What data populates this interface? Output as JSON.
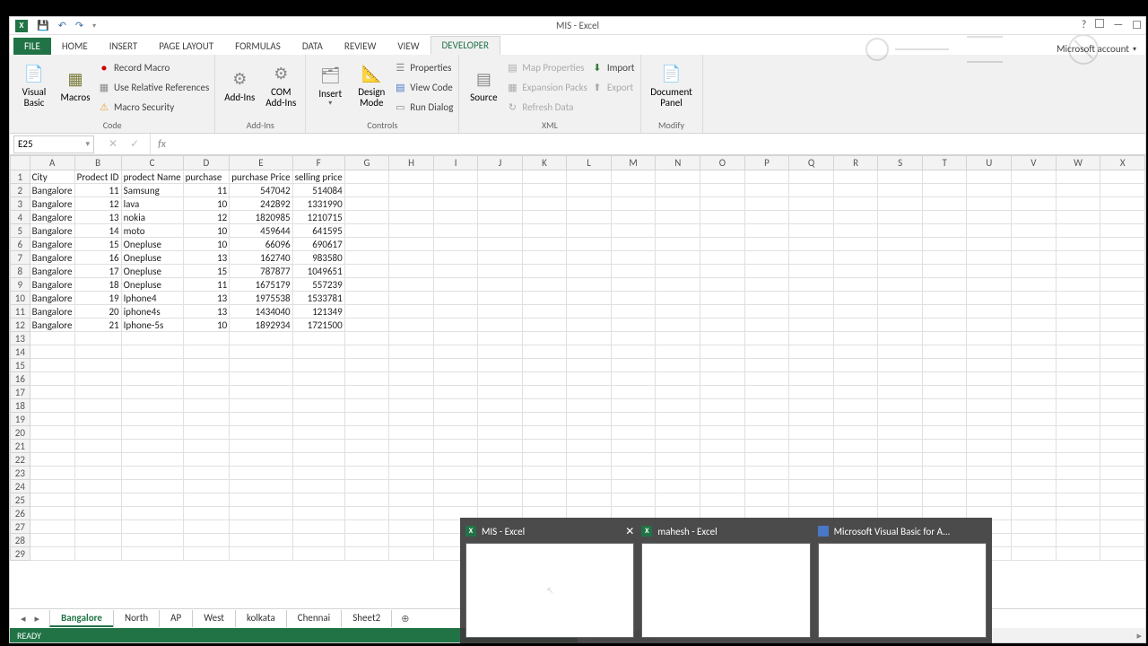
{
  "window": {
    "title": "MIS - Excel",
    "account": "Microsoft account"
  },
  "tabs": {
    "file": "FILE",
    "list": [
      "HOME",
      "INSERT",
      "PAGE LAYOUT",
      "FORMULAS",
      "DATA",
      "REVIEW",
      "VIEW",
      "DEVELOPER"
    ],
    "active": "DEVELOPER"
  },
  "ribbon": {
    "code": {
      "visual_basic": "Visual\nBasic",
      "macros": "Macros",
      "record": "Record Macro",
      "relref": "Use Relative References",
      "security": "Macro Security",
      "label": "Code"
    },
    "addins": {
      "addins": "Add-Ins",
      "com": "COM\nAdd-Ins",
      "label": "Add-Ins"
    },
    "controls": {
      "insert": "Insert",
      "design": "Design\nMode",
      "properties": "Properties",
      "viewcode": "View Code",
      "rundialog": "Run Dialog",
      "label": "Controls"
    },
    "xml": {
      "source": "Source",
      "mapprops": "Map Properties",
      "expansion": "Expansion Packs",
      "refresh": "Refresh Data",
      "import": "Import",
      "export": "Export",
      "label": "XML"
    },
    "modify": {
      "docpanel": "Document\nPanel",
      "label": "Modify"
    }
  },
  "namebox": "E25",
  "columns": [
    "A",
    "B",
    "C",
    "D",
    "E",
    "F",
    "G",
    "H",
    "I",
    "J",
    "K",
    "L",
    "M",
    "N",
    "O",
    "P",
    "Q",
    "R",
    "S",
    "T",
    "U",
    "V",
    "W",
    "X"
  ],
  "headers": [
    "City",
    "Prodect ID",
    "prodect Name",
    "purchase",
    "purchase Price",
    "selling price"
  ],
  "rows": [
    [
      "Bangalore",
      "11",
      "Samsung",
      "11",
      "547042",
      "514084"
    ],
    [
      "Bangalore",
      "12",
      "lava",
      "10",
      "242892",
      "1331990"
    ],
    [
      "Bangalore",
      "13",
      "nokia",
      "12",
      "1820985",
      "1210715"
    ],
    [
      "Bangalore",
      "14",
      "moto",
      "10",
      "459644",
      "641595"
    ],
    [
      "Bangalore",
      "15",
      "Onepluse",
      "10",
      "66096",
      "690617"
    ],
    [
      "Bangalore",
      "16",
      "Onepluse",
      "13",
      "162740",
      "983580"
    ],
    [
      "Bangalore",
      "17",
      "Onepluse",
      "15",
      "787877",
      "1049651"
    ],
    [
      "Bangalore",
      "18",
      "Onepluse",
      "11",
      "1675179",
      "557239"
    ],
    [
      "Bangalore",
      "19",
      "Iphone4",
      "13",
      "1975538",
      "1533781"
    ],
    [
      "Bangalore",
      "20",
      "iphone4s",
      "13",
      "1434040",
      "121349"
    ],
    [
      "Bangalore",
      "21",
      "Iphone-5s",
      "10",
      "1892934",
      "1721500"
    ]
  ],
  "visible_rows": 29,
  "sheets": {
    "list": [
      "Bangalore",
      "North",
      "AP",
      "West",
      "kolkata",
      "Chennai",
      "Sheet2"
    ],
    "active": "Bangalore"
  },
  "status": "READY",
  "taskbar": {
    "items": [
      {
        "label": "MIS - Excel",
        "type": "excel",
        "close": true
      },
      {
        "label": "mahesh - Excel",
        "type": "excel",
        "close": false
      },
      {
        "label": "Microsoft Visual Basic for A...",
        "type": "vba",
        "close": false
      }
    ]
  }
}
